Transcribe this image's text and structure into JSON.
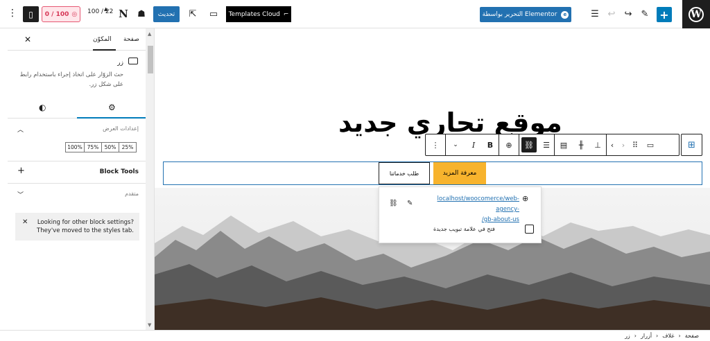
{
  "topbar": {
    "elementor_label": "التحرير بواسطة Elementor",
    "templates_cloud_label": "Templates Cloud",
    "update_label": "تحديث",
    "score_label": "100 / 22",
    "seo_score_label": "0 / 100"
  },
  "sidebar": {
    "tab_page": "صفحة",
    "tab_block": "المكوّن",
    "block_title": "زر",
    "block_description": "حث الزوّار على اتخاذ إجراء باستخدام رابط على شكل زر.",
    "display_settings_title": "إعدادات العرض",
    "width_options": [
      "100%",
      "75%",
      "50%",
      "25%"
    ],
    "block_tools_title": "Block Tools",
    "advanced_title": "متقدم",
    "notice_text": "Looking for other block settings? They've moved to the styles tab."
  },
  "canvas": {
    "heading": "موقع تجاري جديد",
    "button_more": "معرفة المزيد",
    "button_services": "طلب خدماتنا",
    "link_url": "localhost/woocomerce/web-agency-/gb-about-us",
    "link_url_line1": "localhost/woocomerce/web-agency-",
    "link_url_line2": "/gb-about-us",
    "new_tab_label": "فتح في علامة تبويب جديدة"
  },
  "footer": {
    "breadcrumbs": [
      "صفحة",
      "غلاف",
      "أزرار",
      "زر"
    ]
  },
  "colors": {
    "accent": "#2271b1",
    "button_yellow": "#f7b32d",
    "seo_red": "#d63655"
  }
}
